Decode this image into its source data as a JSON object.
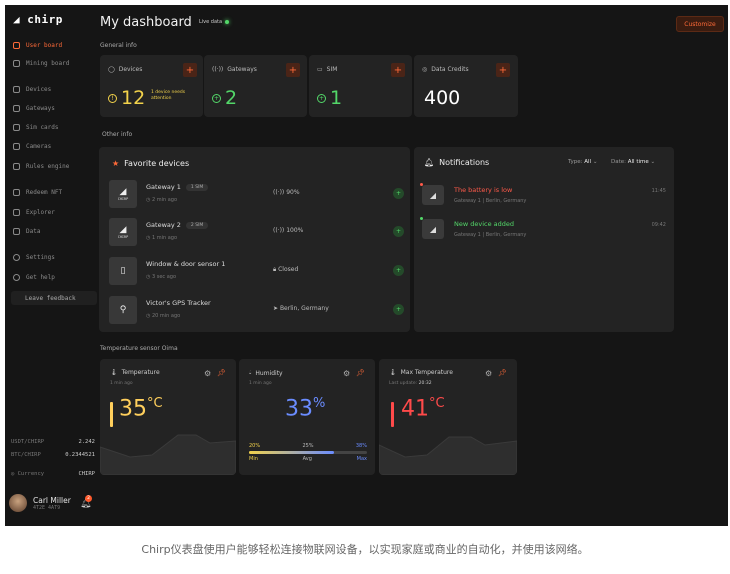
{
  "brand": {
    "name": "chirp"
  },
  "sidebar": {
    "items": [
      {
        "label": "User board",
        "icon": "user-icon",
        "active": true
      },
      {
        "label": "Mining board",
        "icon": "mining-icon"
      },
      {
        "label": "Devices",
        "icon": "devices-icon"
      },
      {
        "label": "Gateways",
        "icon": "gateway-icon"
      },
      {
        "label": "Sim cards",
        "icon": "sim-icon"
      },
      {
        "label": "Cameras",
        "icon": "camera-icon"
      },
      {
        "label": "Rules engine",
        "icon": "rules-icon"
      },
      {
        "label": "Redeem NFT",
        "icon": "nft-icon"
      },
      {
        "label": "Explorer",
        "icon": "explorer-icon"
      },
      {
        "label": "Data",
        "icon": "data-icon"
      },
      {
        "label": "Settings",
        "icon": "gear-icon"
      },
      {
        "label": "Get help",
        "icon": "help-icon"
      }
    ],
    "feedback_label": "Leave feedback",
    "prices": [
      {
        "pair": "USDT/CHIRP",
        "value": "2.242"
      },
      {
        "pair": "BTC/CHIRP",
        "value": "0.2344521"
      }
    ],
    "currency_label": "Currency",
    "currency_value": "CHIRP",
    "user": {
      "name": "Carl Miller",
      "address": "4T2E 4AT9",
      "notifications": "2"
    }
  },
  "header": {
    "title": "My dashboard",
    "live_label": "Live data",
    "customize_label": "Customize"
  },
  "general": {
    "section_label": "General info",
    "cards": [
      {
        "label": "Devices",
        "value": "12",
        "note": "1 device needs attention",
        "color": "#f2d24b",
        "icon": "devices-icon"
      },
      {
        "label": "Gateways",
        "value": "2",
        "color": "#53d769",
        "icon": "gateway-icon"
      },
      {
        "label": "SIM",
        "value": "1",
        "color": "#53d769",
        "icon": "sim-icon"
      },
      {
        "label": "Data Credits",
        "value": "400",
        "color": "#ffffff",
        "icon": "credits-icon"
      }
    ]
  },
  "other": {
    "section_label": "Other info",
    "favorites": {
      "title": "Favorite devices",
      "devices": [
        {
          "name": "Gateway 1",
          "pill": "1 SIM",
          "time": "2 min ago",
          "status": "90%",
          "status_icon": "signal-icon",
          "icon": "gateway-chirp-icon",
          "icon_text": "CHIRP"
        },
        {
          "name": "Gateway 2",
          "pill": "2 SIM",
          "time": "1 min ago",
          "status": "100%",
          "status_icon": "signal-icon",
          "icon": "gateway-chirp-icon",
          "icon_text": "CHIRP"
        },
        {
          "name": "Window & door sensor 1",
          "pill": "",
          "time": "3 sec ago",
          "status": "Closed",
          "status_icon": "lock-icon",
          "icon": "door-icon",
          "icon_text": ""
        },
        {
          "name": "Victor's GPS Tracker",
          "pill": "",
          "time": "20 min ago",
          "status": "Berlin, Germany",
          "status_icon": "location-arrow-icon",
          "icon": "map-pin-icon",
          "icon_text": ""
        }
      ]
    },
    "notifications": {
      "title": "Notifications",
      "type_label": "Type:",
      "type_value": "All",
      "date_label": "Date:",
      "date_value": "All time",
      "items": [
        {
          "title": "The battery is low",
          "sub": "Gateway 1 | Berlin, Germany",
          "time": "11:45",
          "color": "#ff5a4a"
        },
        {
          "title": "New device added",
          "sub": "Gateway 1 | Berlin, Germany",
          "time": "09:42",
          "color": "#53d769"
        }
      ]
    }
  },
  "sensors": {
    "section_label": "Temperature sensor Oima",
    "cards": [
      {
        "title": "Temperature",
        "sub": "1 min ago",
        "value": "35",
        "unit": "°C",
        "color": "#ffcf5c",
        "icon": "thermometer-icon"
      },
      {
        "title": "Humidity",
        "sub": "1 min ago",
        "value": "33",
        "unit": "%",
        "color": "#6a8cff",
        "icon": "droplet-icon",
        "scale": {
          "min_val": "20%",
          "avg_val": "25%",
          "max_val": "38%",
          "min": "Min",
          "avg": "Avg",
          "max": "Max",
          "level": 0.72
        }
      },
      {
        "title": "Max Temperature",
        "sub": "Last update:",
        "sub_time": "20:32",
        "value": "41",
        "unit": "°C",
        "color": "#ff4a4a",
        "icon": "thermometer-icon"
      }
    ]
  },
  "caption": "Chirp仪表盘使用户能够轻松连接物联网设备，以实现家庭或商业的自动化，并使用该网络。"
}
